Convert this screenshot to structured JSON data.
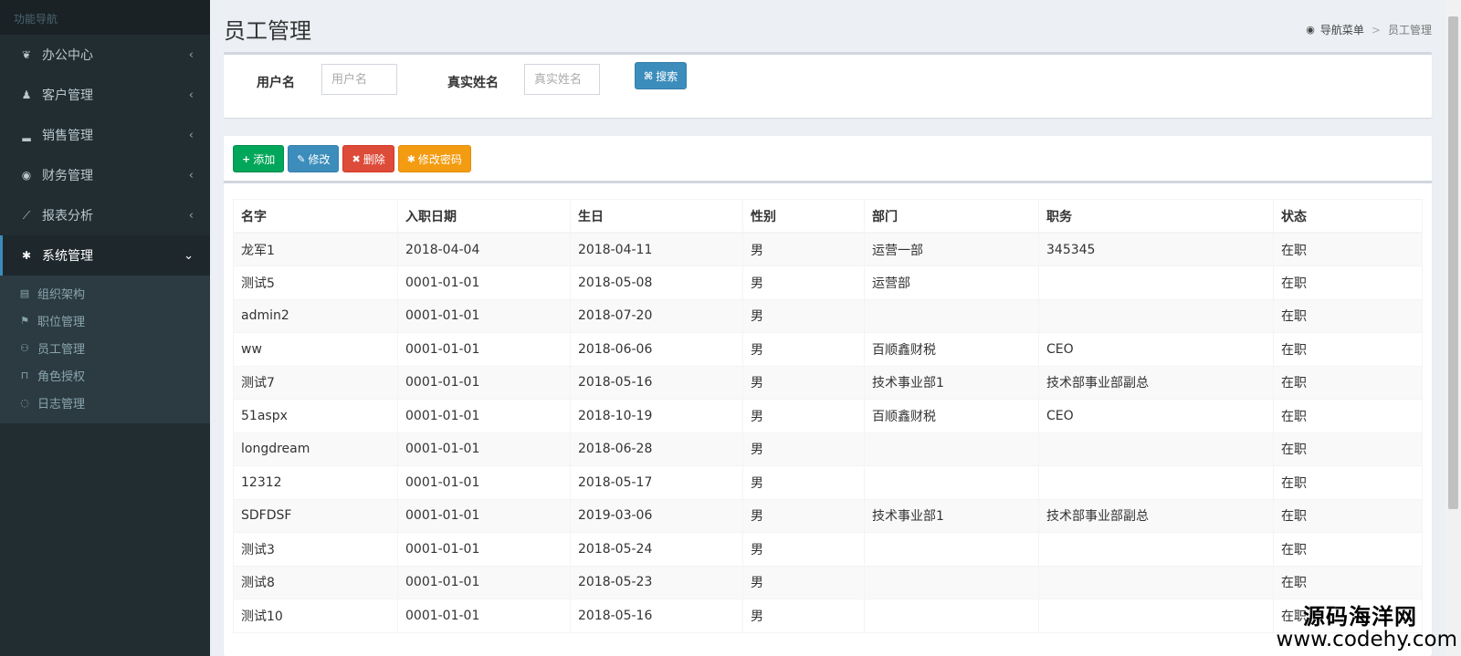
{
  "sidebar": {
    "header": "功能导航",
    "menu": [
      {
        "label": "办公中心",
        "icon": "leaf-icon",
        "glyph": "❦",
        "chev": "‹"
      },
      {
        "label": "客户管理",
        "icon": "person-icon",
        "glyph": "♟",
        "chev": "‹"
      },
      {
        "label": "销售管理",
        "icon": "signal-bars-icon",
        "glyph": "▂",
        "chev": "‹"
      },
      {
        "label": "财务管理",
        "icon": "eye-icon",
        "glyph": "◉",
        "chev": "‹"
      },
      {
        "label": "报表分析",
        "icon": "line-chart-icon",
        "glyph": "⟋",
        "chev": "‹"
      },
      {
        "label": "系统管理",
        "icon": "gear-icon",
        "glyph": "✱",
        "chev": "⌄"
      }
    ],
    "submenu": [
      {
        "label": "组织架构",
        "glyph": "▤"
      },
      {
        "label": "职位管理",
        "glyph": "⚑"
      },
      {
        "label": "员工管理",
        "glyph": "⚇"
      },
      {
        "label": "角色授权",
        "glyph": "⊓"
      },
      {
        "label": "日志管理",
        "glyph": "◌"
      }
    ]
  },
  "header": {
    "title": "员工管理",
    "breadcrumb_icon": "◉",
    "breadcrumb_root": "导航菜单",
    "breadcrumb_sep": ">",
    "breadcrumb_current": "员工管理"
  },
  "search": {
    "username_label": "用户名",
    "username_placeholder": "用户名",
    "realname_label": "真实姓名",
    "realname_placeholder": "真实姓名",
    "search_icon": "⌘",
    "search_label": "搜索"
  },
  "toolbar": {
    "add_icon": "+",
    "add_label": "添加",
    "edit_icon": "✎",
    "edit_label": "修改",
    "delete_icon": "✖",
    "delete_label": "删除",
    "password_icon": "✱",
    "password_label": "修改密码"
  },
  "table": {
    "columns": [
      "名字",
      "入职日期",
      "生日",
      "性别",
      "部门",
      "职务",
      "状态"
    ],
    "rows": [
      [
        "龙军1",
        "2018-04-04",
        "2018-04-11",
        "男",
        "运营一部",
        "345345",
        "在职"
      ],
      [
        "测试5",
        "0001-01-01",
        "2018-05-08",
        "男",
        "运营部",
        "",
        "在职"
      ],
      [
        "admin2",
        "0001-01-01",
        "2018-07-20",
        "男",
        "",
        "",
        "在职"
      ],
      [
        "ww",
        "0001-01-01",
        "2018-06-06",
        "男",
        "百顺鑫财税",
        "CEO",
        "在职"
      ],
      [
        "测试7",
        "0001-01-01",
        "2018-05-16",
        "男",
        "技术事业部1",
        "技术部事业部副总",
        "在职"
      ],
      [
        "51aspx",
        "0001-01-01",
        "2018-10-19",
        "男",
        "百顺鑫财税",
        "CEO",
        "在职"
      ],
      [
        "longdream",
        "0001-01-01",
        "2018-06-28",
        "男",
        "",
        "",
        "在职"
      ],
      [
        "12312",
        "0001-01-01",
        "2018-05-17",
        "男",
        "",
        "",
        "在职"
      ],
      [
        "SDFDSF",
        "0001-01-01",
        "2019-03-06",
        "男",
        "技术事业部1",
        "技术部事业部副总",
        "在职"
      ],
      [
        "测试3",
        "0001-01-01",
        "2018-05-24",
        "男",
        "",
        "",
        "在职"
      ],
      [
        "测试8",
        "0001-01-01",
        "2018-05-23",
        "男",
        "",
        "",
        "在职"
      ],
      [
        "测试10",
        "0001-01-01",
        "2018-05-16",
        "男",
        "",
        "",
        "在职"
      ]
    ]
  },
  "watermark": {
    "cn": "源码海洋网",
    "url": "www.codehy.com"
  }
}
